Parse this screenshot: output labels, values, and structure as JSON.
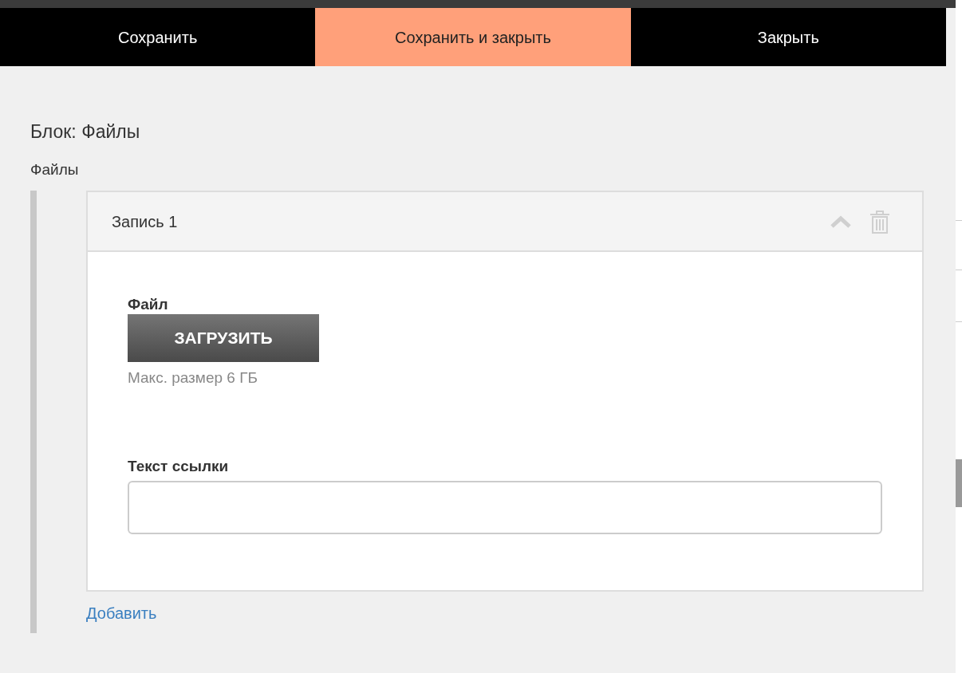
{
  "toolbar": {
    "buttons": [
      {
        "label": "Сохранить",
        "selected": false
      },
      {
        "label": "Сохранить и закрыть",
        "selected": true
      },
      {
        "label": "Закрыть",
        "selected": false
      }
    ]
  },
  "block_title": "Блок: Файлы",
  "section_label": "Файлы",
  "records": [
    {
      "title": "Запись 1",
      "expanded": true,
      "file_label": "Файл",
      "upload_button": "ЗАГРУЗИТЬ",
      "upload_hint": "Макс. размер 6 ГБ",
      "link_text_label": "Текст ссылки"
    }
  ],
  "add_link": "Добавить"
}
